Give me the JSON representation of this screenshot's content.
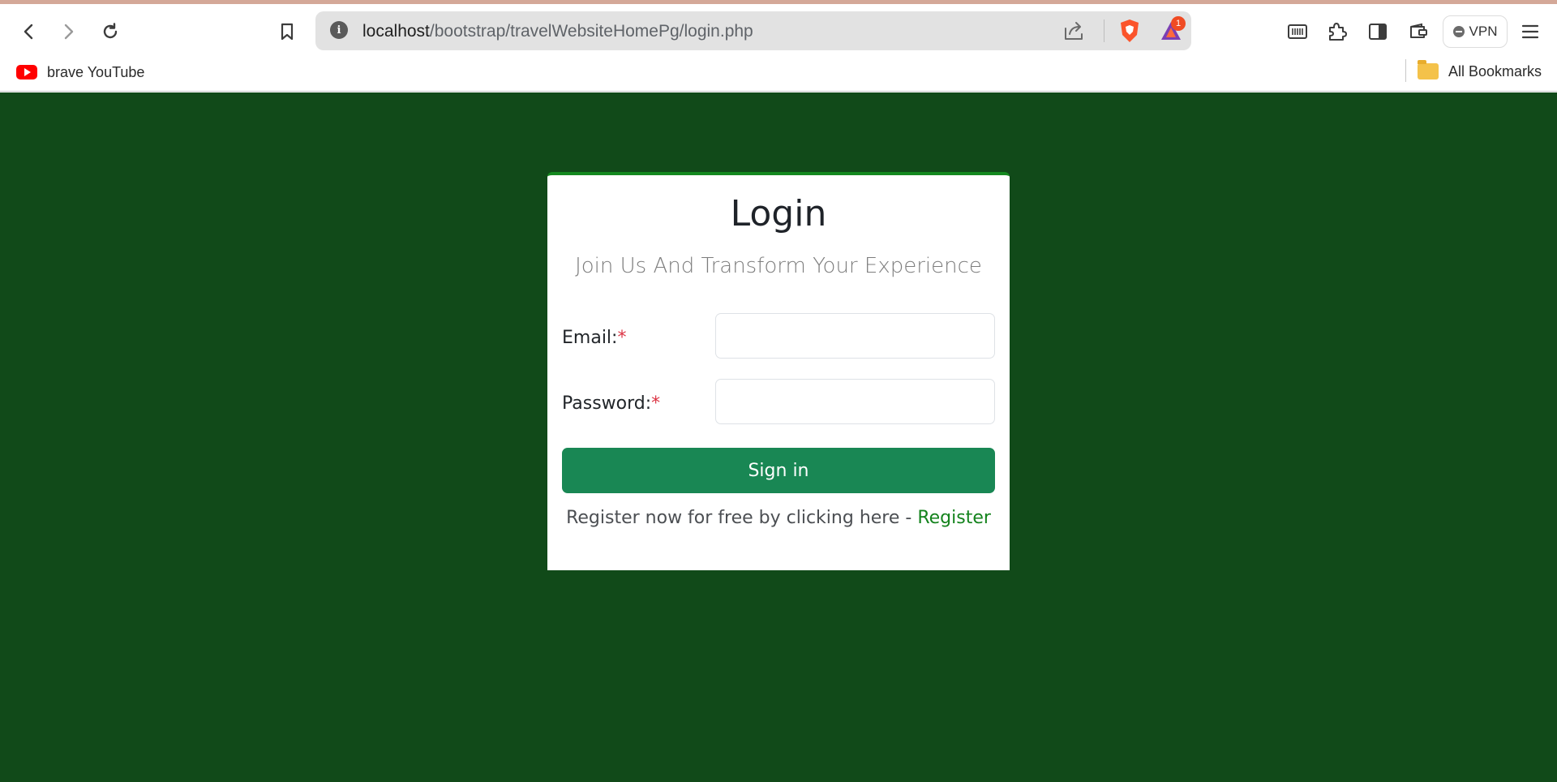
{
  "browser": {
    "address_host": "localhost",
    "address_path": "/bootstrap/travelWebsiteHomePg/login.php",
    "rewards_badge": "1",
    "vpn_label": "VPN"
  },
  "bookmarks": {
    "items": [
      {
        "label": "brave YouTube"
      }
    ],
    "all_bookmarks_label": "All Bookmarks"
  },
  "login_card": {
    "title": "Login",
    "subtitle": "Join Us And Transform Your Experience",
    "email_label": "Email:",
    "password_label": "Password:",
    "required_mark": "*",
    "email_value": "",
    "password_value": "",
    "sign_in_label": "Sign in",
    "register_prompt": "Register now for free by clicking here - ",
    "register_link": "Register"
  },
  "colors": {
    "page_background": "#114a19",
    "card_border_accent": "#14891f",
    "sign_in_button": "#198754",
    "register_link": "#14831d",
    "required_mark": "#dc3545"
  }
}
